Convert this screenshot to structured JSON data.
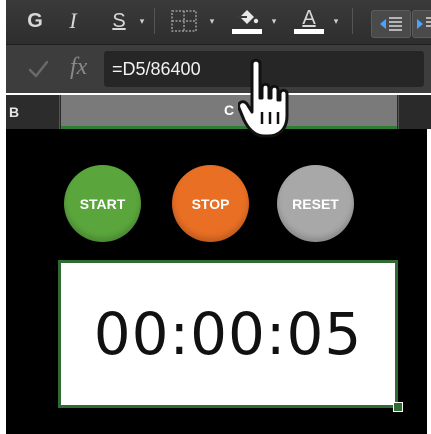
{
  "toolbar": {
    "bold_label": "G",
    "italic_label": "I",
    "underline_label": "S",
    "font_color_label": "A",
    "caret": "▾",
    "colors": {
      "toolbar_bg": "#333333",
      "indent_icon": "#4aa3ff"
    }
  },
  "formula_bar": {
    "fx_label": "fx",
    "formula": "=D5/86400"
  },
  "columns": {
    "b": "B",
    "c": "C"
  },
  "sheet": {
    "start_label": "START",
    "stop_label": "STOP",
    "reset_label": "RESET",
    "timer": "00:00:05",
    "colors": {
      "start": "#5aa63c",
      "stop": "#e86f24",
      "reset": "#a8a8a8",
      "timer_border": "#2f6b33"
    }
  },
  "cursor": {
    "icon": "pointing-hand-icon"
  }
}
